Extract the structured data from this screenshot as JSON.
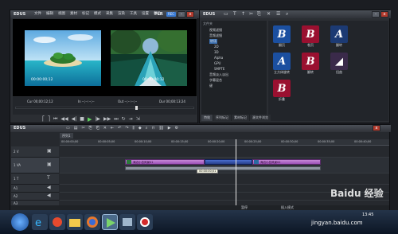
{
  "player": {
    "title": "EDUS",
    "menu": [
      "文件",
      "编辑",
      "视图",
      "素材",
      "标记",
      "模式",
      "采集",
      "渲染",
      "工具",
      "设置",
      "帮助"
    ],
    "mode": "PLR",
    "rec": "REC",
    "left_timecode": "00:00:00;12",
    "right_timecode": "00:00:00;12",
    "cur_label": "Cur 00;00:12;12",
    "in_label": "In --;--:--;--",
    "out_label": "Out --;--:--;--",
    "dur_label": "Dur 00;00:13:24"
  },
  "bin": {
    "title": "EDUS",
    "tree_header": "文件夹",
    "tree": [
      "视频滤镜",
      "音频滤镜",
      "转场",
      "2D",
      "3D",
      "Alpha",
      "GPU",
      "SMPTE",
      "音频淡入淡出",
      "字幕混合",
      "键"
    ],
    "effects": [
      {
        "label": "翻页",
        "color": "#1b4fa0"
      },
      {
        "label": "卷页",
        "color": "#9a1030"
      },
      {
        "label": "翻转",
        "color": "#1c3a73"
      },
      {
        "label": "立方体旋转",
        "color": "#1b4fa0"
      },
      {
        "label": "翻转",
        "color": "#9a1030"
      },
      {
        "label": "扭曲",
        "color": "#3a2a4a"
      },
      {
        "label": "折叠",
        "color": "#9a1030"
      }
    ],
    "tabs": [
      "特效",
      "序列标记",
      "素材标记",
      "源文件浏览"
    ]
  },
  "timeline": {
    "title": "EDUS",
    "sequence": "序列1",
    "ruler": [
      "00:00:00;00",
      "00:00:05;00",
      "00:00:10;00",
      "00:00:15;00",
      "00:00:20;00",
      "00:00:25;00",
      "00:00:30;00",
      "00:00:35;00",
      "00:00:40;00"
    ],
    "tracks": [
      "2 V",
      "1 VA",
      "1 T",
      "A1",
      "A2",
      "A3"
    ],
    "clip1": "海边小岛风景01",
    "clip2": "海边小岛风景02",
    "transition_tooltip": "00:00:00;01",
    "status_left": "暂停",
    "status_right": "插入模式"
  },
  "watermark": {
    "brand": "Baidu 经验",
    "url": "jingyan.baidu.com"
  },
  "taskbar": {
    "icons": [
      "start-orb",
      "ie",
      "folder",
      "media",
      "firefox",
      "edius",
      "window",
      "record"
    ],
    "clock_time": "13:45",
    "clock_date": "2015/4/18"
  }
}
